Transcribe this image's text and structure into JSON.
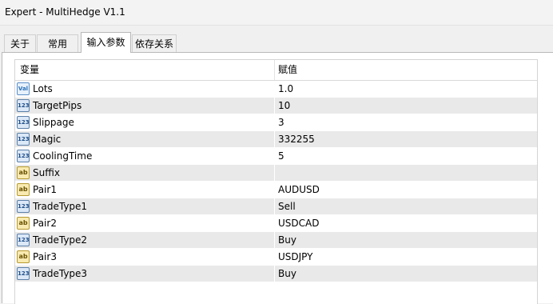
{
  "window": {
    "title": "Expert - MultiHedge V1.1"
  },
  "tabs": [
    {
      "label": "关于"
    },
    {
      "label": "常用"
    },
    {
      "label": "输入参数"
    },
    {
      "label": "依存关系"
    }
  ],
  "active_tab": "输入参数",
  "grid": {
    "headers": {
      "variable": "变量",
      "value": "赋值"
    },
    "rows": [
      {
        "icon": "double-type-icon",
        "icon_text": "Val",
        "name": "Lots",
        "value": "1.0"
      },
      {
        "icon": "int-type-icon",
        "icon_text": "123",
        "name": "TargetPips",
        "value": "10"
      },
      {
        "icon": "int-type-icon",
        "icon_text": "123",
        "name": "Slippage",
        "value": "3"
      },
      {
        "icon": "int-type-icon",
        "icon_text": "123",
        "name": "Magic",
        "value": "332255"
      },
      {
        "icon": "int-type-icon",
        "icon_text": "123",
        "name": "CoolingTime",
        "value": "5"
      },
      {
        "icon": "string-type-icon",
        "icon_text": "ab",
        "name": "Suffix",
        "value": ""
      },
      {
        "icon": "string-type-icon",
        "icon_text": "ab",
        "name": "Pair1",
        "value": "AUDUSD"
      },
      {
        "icon": "int-type-icon",
        "icon_text": "123",
        "name": "TradeType1",
        "value": "Sell"
      },
      {
        "icon": "string-type-icon",
        "icon_text": "ab",
        "name": "Pair2",
        "value": "USDCAD"
      },
      {
        "icon": "int-type-icon",
        "icon_text": "123",
        "name": "TradeType2",
        "value": "Buy"
      },
      {
        "icon": "string-type-icon",
        "icon_text": "ab",
        "name": "Pair3",
        "value": "USDJPY"
      },
      {
        "icon": "int-type-icon",
        "icon_text": "123",
        "name": "TradeType3",
        "value": "Buy"
      }
    ]
  }
}
